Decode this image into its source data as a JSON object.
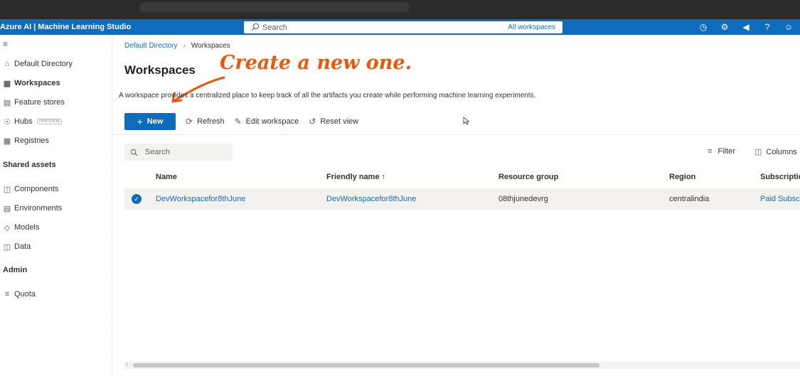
{
  "app": {
    "title": "Azure AI | Machine Learning Studio",
    "search_placeholder": "Search",
    "search_scope": "All workspaces",
    "top_icons": [
      "clock-icon",
      "gear-icon",
      "megaphone-icon",
      "help-icon",
      "smiley-icon"
    ]
  },
  "sidebar": {
    "items": [
      {
        "label": "Default Directory",
        "icon": "home-icon"
      },
      {
        "label": "Workspaces",
        "icon": "workspace-icon",
        "active": true
      },
      {
        "label": "Feature stores",
        "icon": "feature-store-icon"
      },
      {
        "label": "Hubs",
        "icon": "hub-icon",
        "badge": "PREVIEW"
      },
      {
        "label": "Registries",
        "icon": "registry-icon"
      }
    ],
    "section_shared": "Shared assets",
    "shared_items": [
      {
        "label": "Components",
        "icon": "components-icon"
      },
      {
        "label": "Environments",
        "icon": "environments-icon"
      },
      {
        "label": "Models",
        "icon": "models-icon"
      },
      {
        "label": "Data",
        "icon": "data-icon"
      }
    ],
    "section_admin": "Admin",
    "admin_items": [
      {
        "label": "Quota",
        "icon": "quota-icon"
      }
    ]
  },
  "main": {
    "breadcrumb": [
      "Default Directory",
      "Workspaces"
    ],
    "title": "Workspaces",
    "annotation": "Create a new one.",
    "description": "A workspace provides a centralized place to keep track of all the artifacts you create while performing machine learning experiments.",
    "toolbar": {
      "new_label": "New",
      "refresh_label": "Refresh",
      "edit_label": "Edit workspace",
      "reset_label": "Reset view"
    },
    "search_placeholder": "Search",
    "filter_label": "Filter",
    "columns_label": "Columns",
    "table": {
      "headers": [
        "Name",
        "Friendly name ↑",
        "Resource group",
        "Region",
        "Subscription"
      ],
      "rows": [
        [
          "DevWorkspacefor8thJune",
          "DevWorkspacefor8thJune",
          "08thjunedevrg",
          "centralindia",
          "Paid Subscri"
        ]
      ]
    }
  },
  "colors": {
    "accent": "#0f6cbd",
    "annotation": "#e8590c"
  }
}
